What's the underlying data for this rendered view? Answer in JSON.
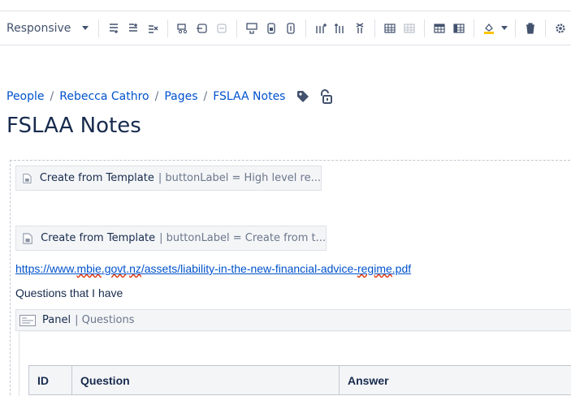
{
  "toolbar": {
    "layout_label": "Responsive",
    "buttons": [
      "insert-row-before-icon",
      "insert-row-after-icon",
      "delete-row-icon",
      "cut-row-icon",
      "copy-row-icon",
      "paste-row-icon",
      "merge-cells-icon",
      "split-cells-icon",
      "table-properties-icon",
      "insert-column-before-icon",
      "insert-column-after-icon",
      "delete-column-icon",
      "header-row-icon",
      "header-column-icon",
      "numbered-table-icon",
      "table-layout-icon",
      "cell-color-icon",
      "delete-table-icon",
      "settings-icon"
    ]
  },
  "breadcrumb": {
    "items": [
      "People",
      "Rebecca Cathro",
      "Pages",
      "FSLAA Notes"
    ]
  },
  "page": {
    "title": "FSLAA Notes"
  },
  "macros": [
    {
      "name": "Create from Template",
      "params": "| buttonLabel = High level re..."
    },
    {
      "name": "Create from Template",
      "params": "| buttonLabel = Create from t..."
    }
  ],
  "content": {
    "link": {
      "before": "https://www.",
      "w1": "mbie",
      "mid1": ".",
      "w2": "govt",
      "mid2": ".",
      "w3": "nz",
      "mid3": "/assets/liability-in-the-new-financial-advice-",
      "w4": "regime",
      "after": ".pdf"
    },
    "questions_text": "Questions that I have"
  },
  "panel": {
    "name": "Panel",
    "title": "| Questions"
  },
  "table": {
    "headers": [
      "ID",
      "Question",
      "Answer"
    ]
  },
  "colors": {
    "link": "#0052cc",
    "text": "#172b4d",
    "muted": "#6b778c",
    "border": "#dfe1e6",
    "macro_bg": "#f4f5f7"
  }
}
